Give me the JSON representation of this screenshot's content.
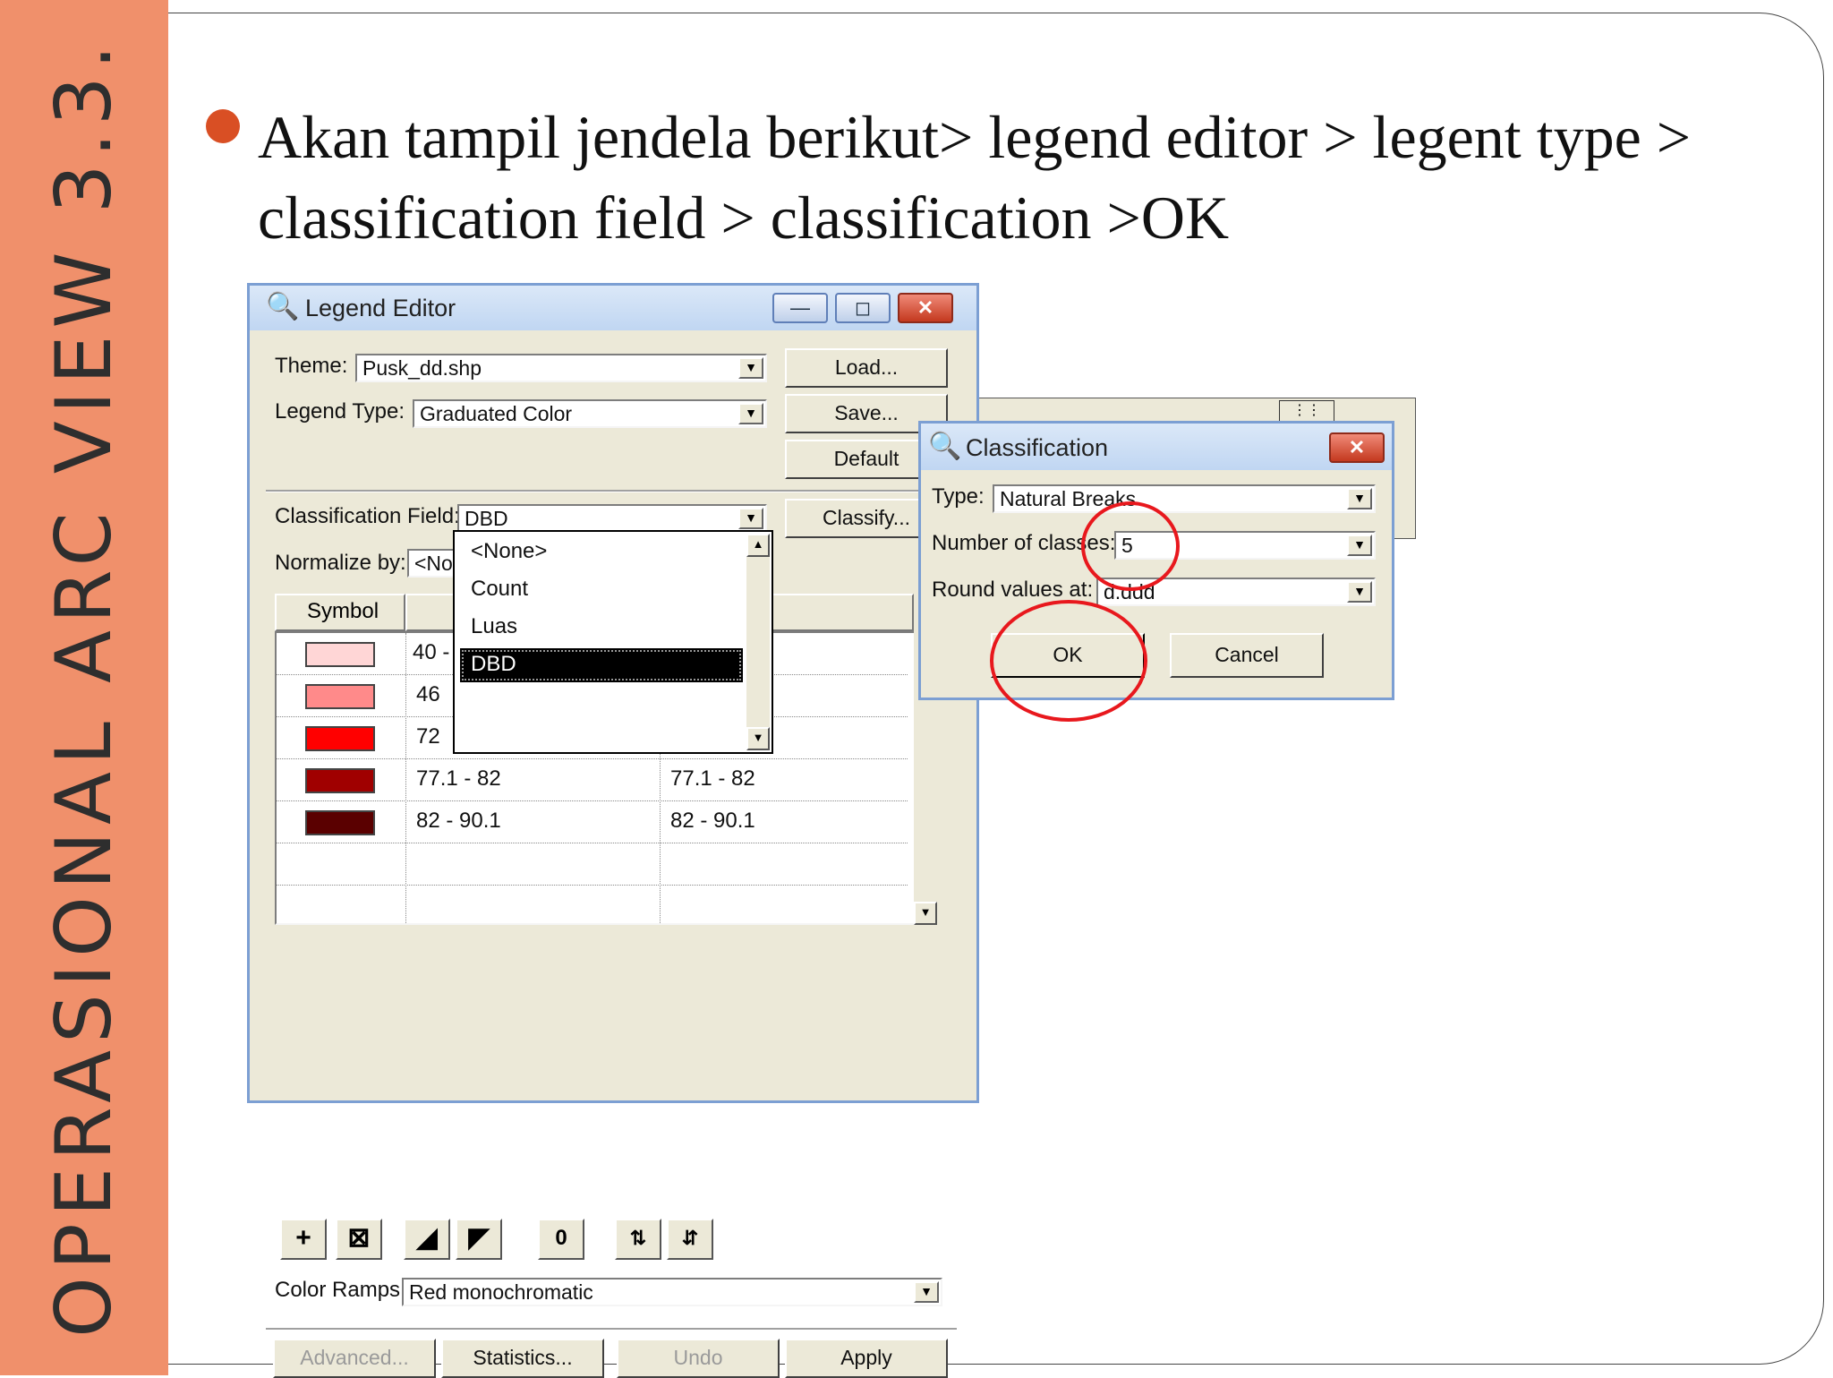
{
  "slide": {
    "vertical_title": "OPERASIONAL ARC VIEW 3.3.",
    "bullet_text": "Akan tampil jendela berikut> legend editor > legent type > classification field > classification >OK",
    "accent_color": "#f0906b",
    "bullet_color": "#d94f24"
  },
  "legend_editor": {
    "title": "Legend Editor",
    "title_icon": "magnifier-globe-icon",
    "theme_label": "Theme:",
    "theme_value": "Pusk_dd.shp",
    "legend_type_label": "Legend Type:",
    "legend_type_value": "Graduated Color",
    "load_label": "Load...",
    "save_label": "Save...",
    "default_label": "Default",
    "classification_field_label": "Classification Field:",
    "classification_field_value": "DBD",
    "classify_label": "Classify...",
    "normalize_label": "Normalize by:",
    "normalize_value": "<No",
    "col_symbol": "Symbol",
    "col_label_partial": "abel",
    "dropdown_options": [
      "<None>",
      "Count",
      "Luas",
      "DBD"
    ],
    "dropdown_selected": "DBD",
    "rows": [
      {
        "color": "#ffd6d6",
        "value": "40 -",
        "label": ""
      },
      {
        "color": "#ff8a8a",
        "value": "46",
        "label": ""
      },
      {
        "color": "#ff0000",
        "value": "72",
        "label": ""
      },
      {
        "color": "#a00000",
        "value": "77.1 - 82",
        "label": "77.1 - 82"
      },
      {
        "color": "#5a0000",
        "value": "82 - 90.1",
        "label": "82 - 90.1"
      }
    ],
    "tools": [
      "add-icon",
      "delete-icon",
      "sort-ascending-icon",
      "sort-descending-icon",
      "null-value-icon",
      "flip-symbols-icon",
      "reverse-order-icon"
    ],
    "color_ramps_label": "Color Ramps:",
    "color_ramps_value": "Red monochromatic",
    "advanced_label": "Advanced...",
    "statistics_label": "Statistics...",
    "undo_label": "Undo",
    "apply_label": "Apply"
  },
  "classification_dialog": {
    "title": "Classification",
    "type_label": "Type:",
    "type_value": "Natural Breaks",
    "classes_label": "Number of classes:",
    "classes_value": "5",
    "round_label": "Round values at:",
    "round_value": "d.ddd",
    "ok_label": "OK",
    "cancel_label": "Cancel",
    "highlight_color": "#e8181d"
  }
}
